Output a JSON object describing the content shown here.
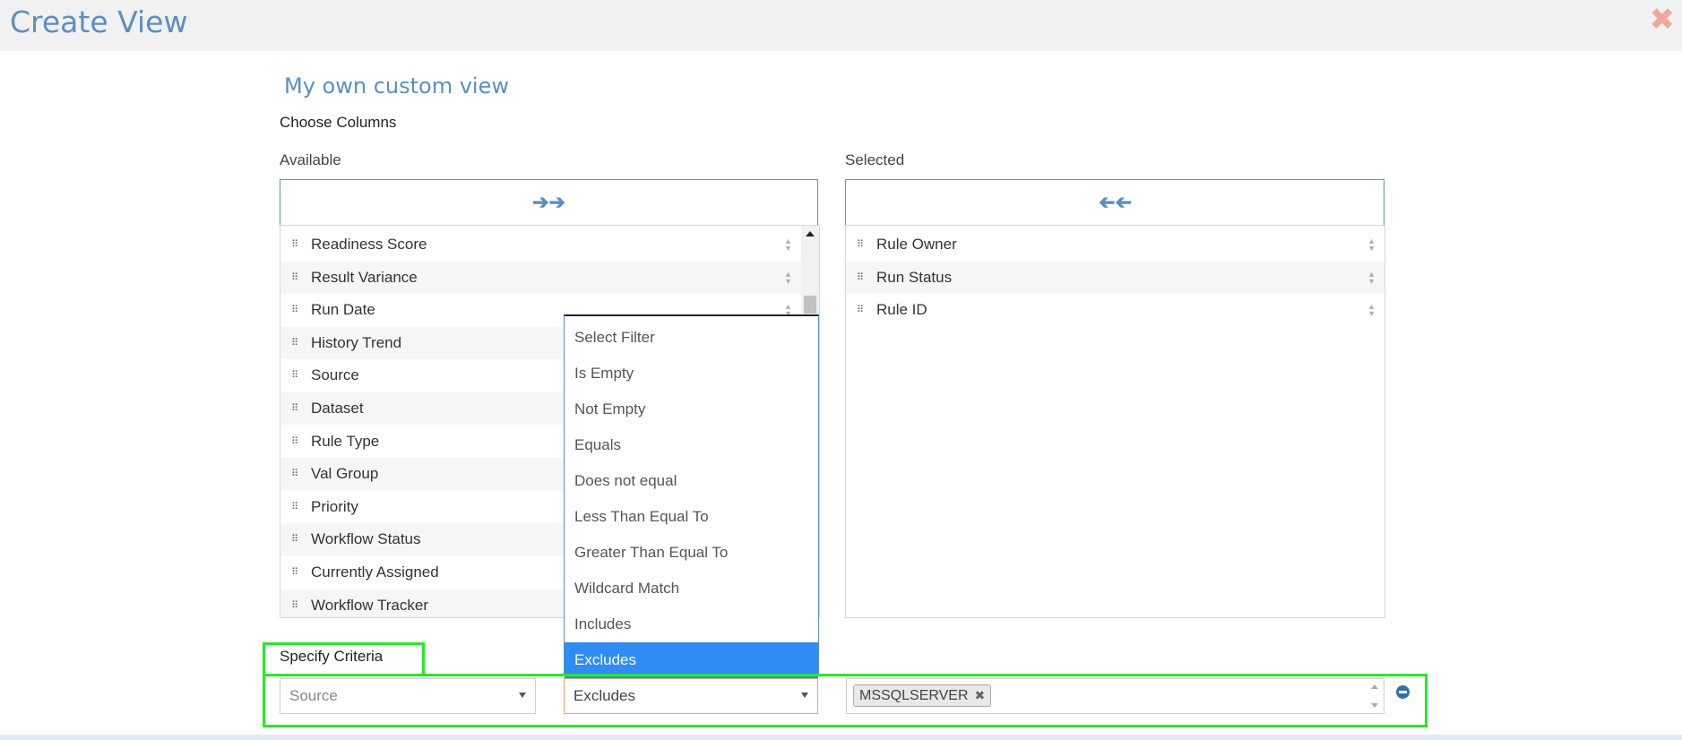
{
  "header": {
    "title": "Create View",
    "close_icon": "close-icon"
  },
  "view_name": "My own custom view",
  "choose_columns_label": "Choose Columns",
  "available": {
    "label": "Available",
    "move_icon": "double-arrow-right-icon",
    "items": [
      "Readiness Score",
      "Result Variance",
      "Run Date",
      "History Trend",
      "Source",
      "Dataset",
      "Rule Type",
      "Val Group",
      "Priority",
      "Workflow Status",
      "Currently Assigned",
      "Workflow Tracker"
    ]
  },
  "selected": {
    "label": "Selected",
    "move_icon": "double-arrow-left-icon",
    "items": [
      "Rule Owner",
      "Run Status",
      "Rule ID"
    ]
  },
  "filter_dropdown": {
    "options": [
      "Select Filter",
      "Is Empty",
      "Not Empty",
      "Equals",
      "Does not equal",
      "Less Than Equal To",
      "Greater Than Equal To",
      "Wildcard Match",
      "Includes",
      "Excludes"
    ],
    "selected": "Excludes"
  },
  "criteria": {
    "label": "Specify Criteria",
    "column_placeholder": "Source",
    "operator_value": "Excludes",
    "tags": [
      "MSSQLSERVER"
    ]
  },
  "colors": {
    "accent": "#5b8fc2",
    "highlight": "#22ee22",
    "selected_option": "#2f8bf5"
  }
}
